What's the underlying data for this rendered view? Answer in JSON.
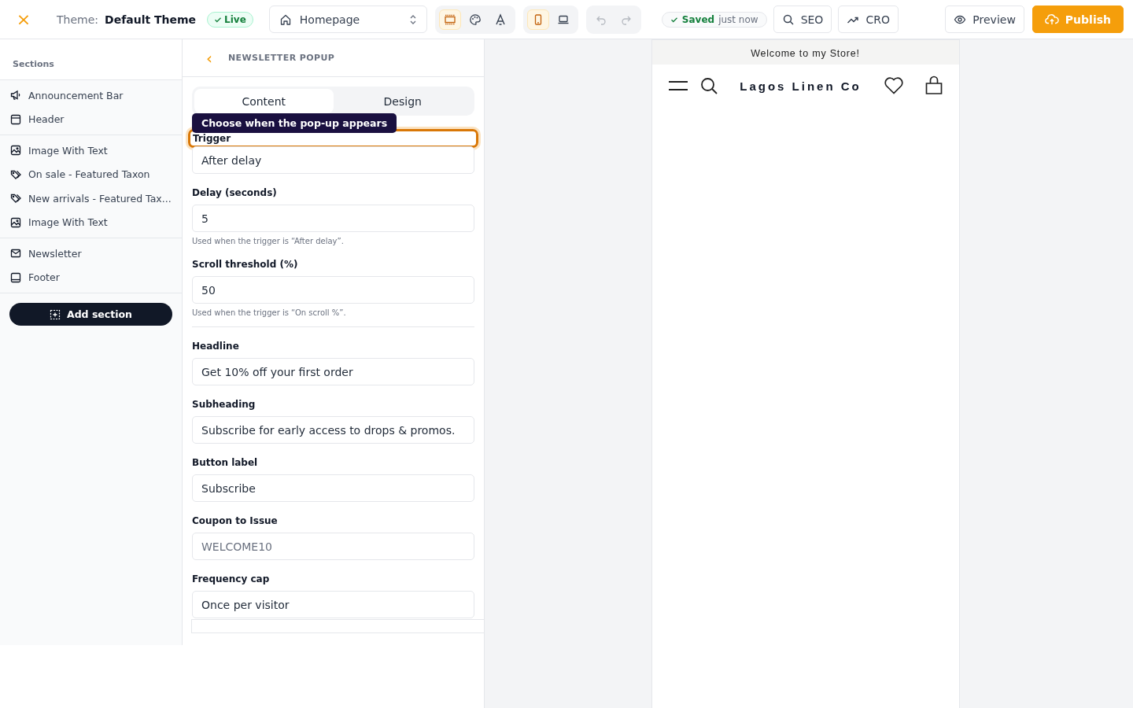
{
  "topbar": {
    "close": "×",
    "theme_label": "Theme:",
    "theme_name": "Default Theme",
    "status_badge": "Live",
    "page_select": "Homepage",
    "tools": [
      {
        "kind": "sections",
        "selected": true
      },
      {
        "kind": "palette",
        "selected": false
      },
      {
        "kind": "type",
        "selected": false
      }
    ],
    "devices": [
      {
        "kind": "mobile",
        "selected": true
      },
      {
        "kind": "desktop",
        "selected": false
      }
    ],
    "history": [
      {
        "kind": "undo",
        "disabled": true
      },
      {
        "kind": "redo",
        "disabled": true
      }
    ],
    "save_state": "Saved",
    "save_time": "just now",
    "buttons": [
      {
        "kind": "seo",
        "label": "SEO"
      },
      {
        "kind": "cro",
        "label": "CRO"
      },
      {
        "kind": "preview",
        "label": "Preview"
      },
      {
        "kind": "publish",
        "label": "Publish"
      }
    ]
  },
  "sidebar": {
    "title": "Sections",
    "groups": [
      {
        "items": [
          {
            "kind": "megaphone",
            "label": "Announcement Bar"
          },
          {
            "kind": "header",
            "label": "Header"
          }
        ]
      },
      {
        "items": [
          {
            "kind": "image",
            "label": "Image With Text"
          },
          {
            "kind": "tag",
            "label": "On sale - Featured Taxon"
          },
          {
            "kind": "tag",
            "label": "New arrivals - Featured Tax..."
          },
          {
            "kind": "image",
            "label": "Image With Text"
          }
        ]
      },
      {
        "items": [
          {
            "kind": "mail",
            "label": "Newsletter"
          },
          {
            "kind": "footer",
            "label": "Footer"
          }
        ]
      }
    ],
    "add_button": "Add section"
  },
  "panel": {
    "back": "‹",
    "title": "NEWSLETTER POPUP",
    "tabs": [
      {
        "label": "Content",
        "selected": true
      },
      {
        "label": "Design",
        "selected": false
      }
    ],
    "tooltip": "Choose when the pop-up appears",
    "fields": [
      {
        "label": "Trigger",
        "value": "After delay",
        "focused": true
      },
      {
        "label": "Delay (seconds)",
        "value": "5",
        "help": "Used when the trigger is “After delay”."
      },
      {
        "label": "Scroll threshold (%)",
        "value": "50",
        "help": "Used when the trigger is “On scroll %”.",
        "divider": true
      },
      {
        "label": "Headline",
        "value": "Get 10% off your first order"
      },
      {
        "label": "Subheading",
        "value": "Subscribe for early access to drops & promos."
      },
      {
        "label": "Button label",
        "value": "Subscribe"
      },
      {
        "label": "Coupon to Issue",
        "placeholder": "WELCOME10"
      },
      {
        "label": "Frequency cap",
        "value": "Once per visitor"
      }
    ]
  },
  "preview": {
    "announcement": "Welcome to my Store!",
    "store_name": "Lagos Linen Co"
  }
}
